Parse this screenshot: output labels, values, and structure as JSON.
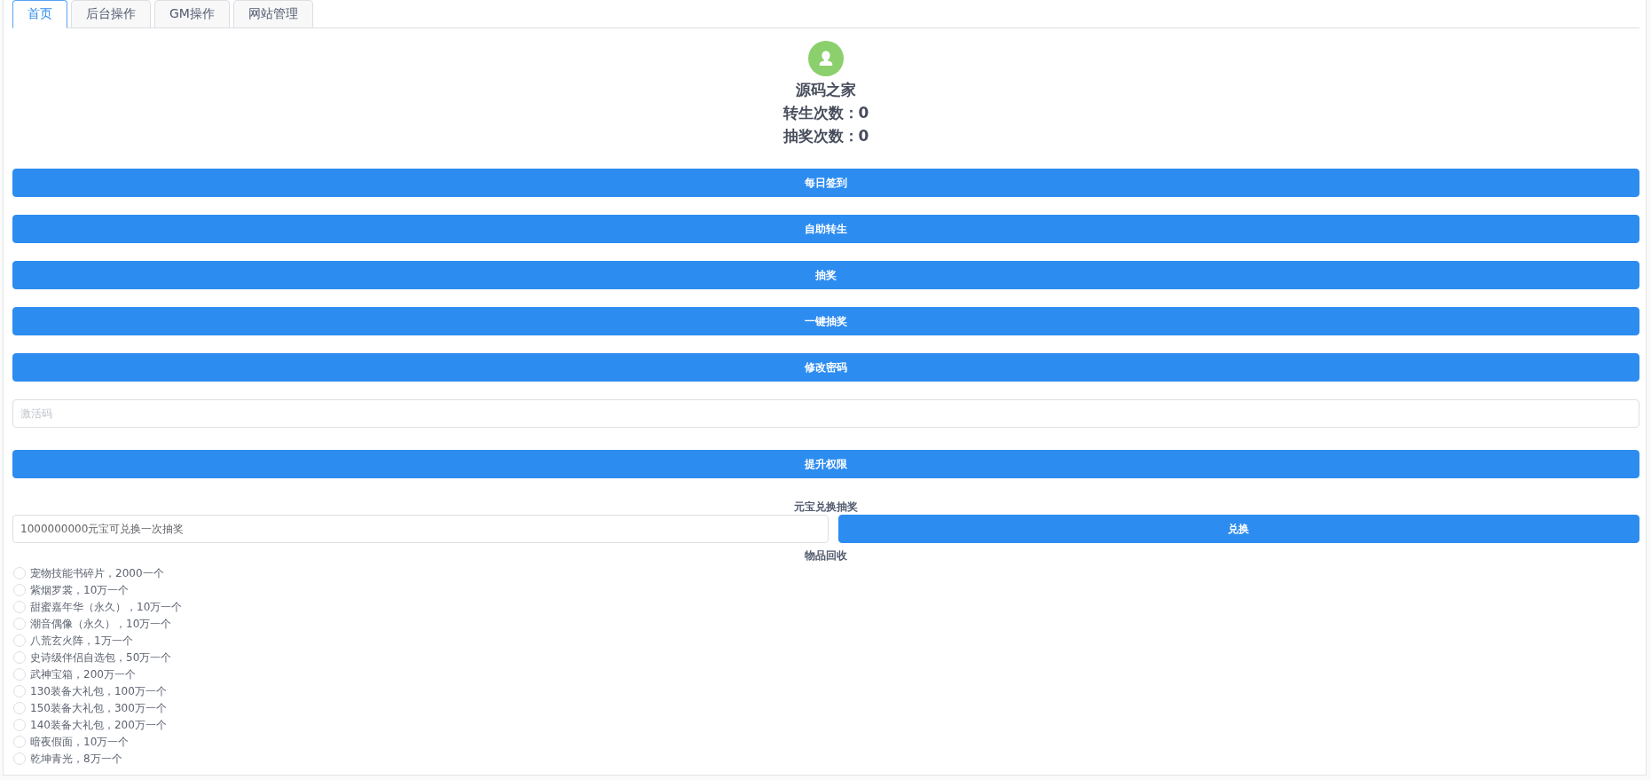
{
  "tabs": [
    {
      "label": "首页",
      "selected": true
    },
    {
      "label": "后台操作",
      "selected": false
    },
    {
      "label": "GM操作",
      "selected": false
    },
    {
      "label": "网站管理",
      "selected": false
    }
  ],
  "profile": {
    "name": "源码之家",
    "stats": [
      "转生次数：0",
      "抽奖次数：0"
    ]
  },
  "action_buttons": [
    "每日签到",
    "自助转生",
    "抽奖",
    "一键抽奖",
    "修改密码"
  ],
  "activation": {
    "placeholder": "激活码",
    "button": "提升权限"
  },
  "exchange": {
    "title": "元宝兑换抽奖",
    "value": "1000000000元宝可兑换一次抽奖",
    "button": "兑换"
  },
  "recycle": {
    "title": "物品回收",
    "items": [
      {
        "label": "宠物技能书碎片，2000一个",
        "selected": false
      },
      {
        "label": "紫烟罗裳，10万一个",
        "selected": false
      },
      {
        "label": "甜蜜嘉年华（永久），10万一个",
        "selected": false
      },
      {
        "label": "潮音偶像（永久），10万一个",
        "selected": false
      },
      {
        "label": "八荒玄火阵，1万一个",
        "selected": false
      },
      {
        "label": "史诗级伴侣自选包，50万一个",
        "selected": false
      },
      {
        "label": "武神宝箱，200万一个",
        "selected": false
      },
      {
        "label": "130装备大礼包，100万一个",
        "selected": false
      },
      {
        "label": "150装备大礼包，300万一个",
        "selected": false
      },
      {
        "label": "140装备大礼包，200万一个",
        "selected": false
      },
      {
        "label": "暗夜假面，10万一个",
        "selected": false
      },
      {
        "label": "乾坤青光，8万一个",
        "selected": false
      }
    ]
  }
}
